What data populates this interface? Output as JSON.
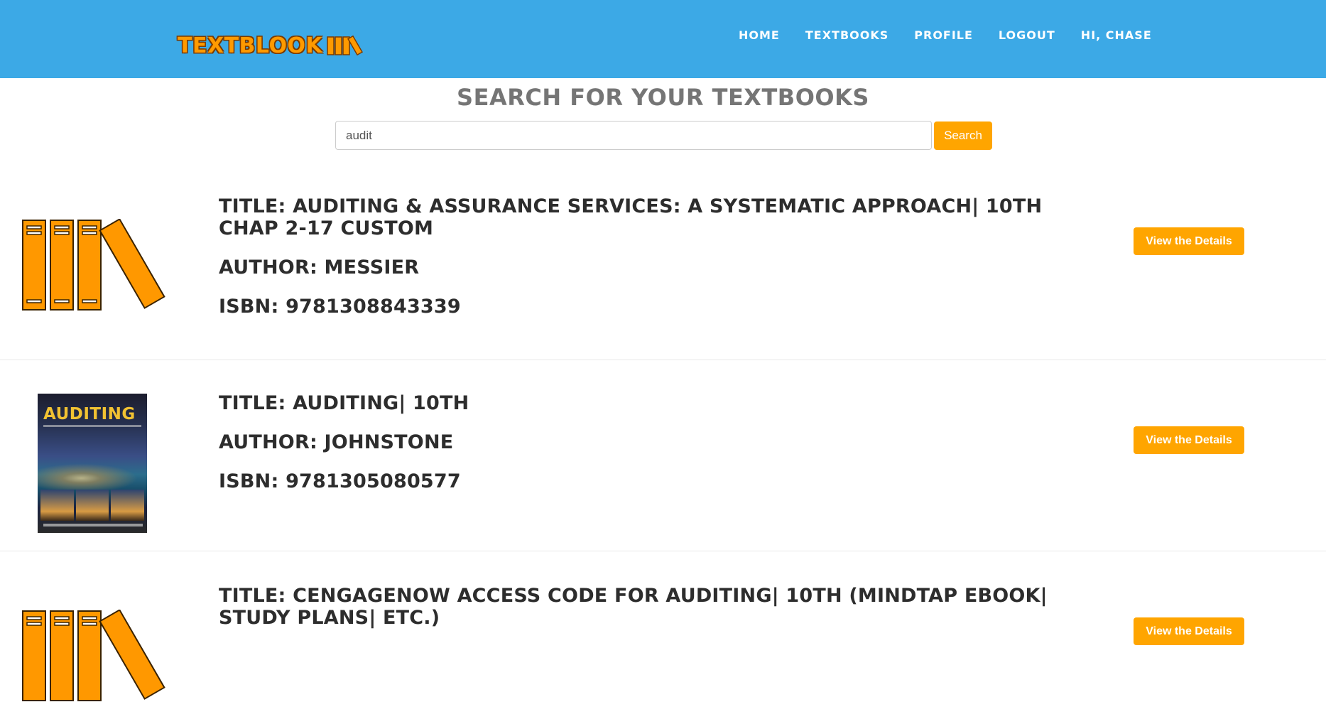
{
  "brand": {
    "name": "TEXTBLOOK"
  },
  "nav": {
    "items": [
      {
        "label": "HOME"
      },
      {
        "label": "TEXTBOOKS"
      },
      {
        "label": "PROFILE"
      },
      {
        "label": "LOGOUT"
      },
      {
        "label": "HI, CHASE"
      }
    ]
  },
  "search": {
    "title": "SEARCH FOR YOUR TEXTBOOKS",
    "value": "audit",
    "button_label": "Search"
  },
  "results": [
    {
      "title": "TITLE: AUDITING & ASSURANCE SERVICES: A SYSTEMATIC APPROACH| 10TH CHAP 2-17 CUSTOM",
      "author": "AUTHOR: MESSIER",
      "isbn": "ISBN: 9781308843339",
      "image": "books-placeholder-icon",
      "button_label": "View the Details"
    },
    {
      "title": "TITLE: AUDITING| 10TH",
      "author": "AUTHOR: JOHNSTONE",
      "isbn": "ISBN: 9781305080577",
      "image": "auditing-book-cover",
      "cover_text": "AUDITING",
      "button_label": "View the Details"
    },
    {
      "title": "TITLE: CENGAGENOW ACCESS CODE FOR AUDITING| 10TH (MINDTAP EBOOK| STUDY PLANS| ETC.)",
      "image": "books-placeholder-icon",
      "button_label": "View the Details"
    }
  ],
  "colors": {
    "header": "#3ca9e6",
    "accent": "#ffa500",
    "heading_gray": "#757575",
    "text_dark": "#2d2d2d"
  }
}
